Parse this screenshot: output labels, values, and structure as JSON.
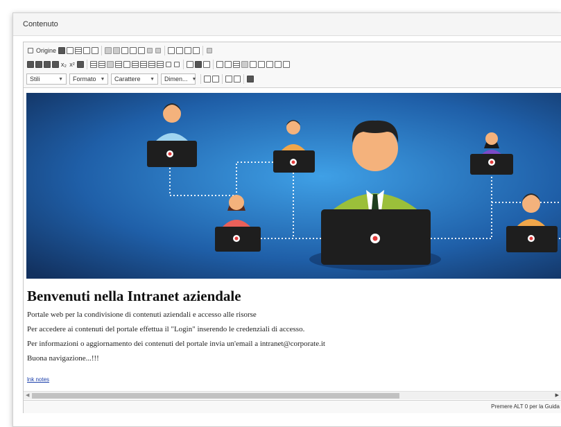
{
  "panel": {
    "title": "Contenuto"
  },
  "toolbar": {
    "source_label": "Origine",
    "combos": [
      {
        "label": "Stili"
      },
      {
        "label": "Formato"
      },
      {
        "label": "Carattere"
      },
      {
        "label": "Dimen..."
      }
    ],
    "subscript_label": "x₂",
    "superscript_label": "x²"
  },
  "document": {
    "heading": "Benvenuti nella Intranet aziendale",
    "paragraphs": [
      "Portale web per la condivisione di contenuti aziendali e accesso alle risorse",
      "Per accedere ai contenuti del portale effettua il \"Login\" inserendo le credenziali di accesso.",
      "Per informazioni o aggiornamento dei contenuti del portale invia un'email a intranet@corporate.it",
      "Buona navigazione...!!!"
    ],
    "link": "lnk notes"
  },
  "status": {
    "help_text": "Premere ALT 0 per la Guida"
  },
  "colors": {
    "banner_bg": "#1f5fa8",
    "banner_glow": "#3fa0e6",
    "laptop": "#1e1e1e",
    "node": "#e23b3b"
  }
}
